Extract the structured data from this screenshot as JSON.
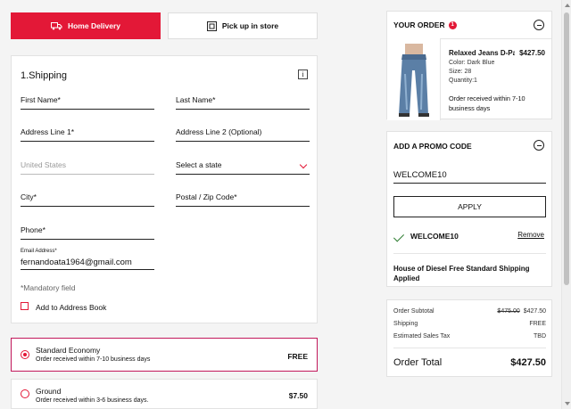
{
  "delivery": {
    "home_label": "Home Delivery",
    "pickup_label": "Pick up in store"
  },
  "shipping": {
    "title": "1.Shipping",
    "first_name": "First Name*",
    "last_name": "Last Name*",
    "address1": "Address Line 1*",
    "address2": "Address Line 2 (Optional)",
    "country": "United States",
    "state": "Select a state",
    "city": "City*",
    "postal": "Postal / Zip Code*",
    "phone": "Phone*",
    "email_label": "Email Address*",
    "email_value": "fernandoata1964@gmail.com",
    "mandatory": "*Mandatory field",
    "address_book": "Add to Address Book"
  },
  "shipping_options": [
    {
      "name": "Standard Economy",
      "sub": "Order received within 7-10 business days",
      "price": "FREE",
      "selected": true
    },
    {
      "name": "Ground",
      "sub": "Order received within 3-6 business days.",
      "price": "$7.50",
      "selected": false
    }
  ],
  "order": {
    "title": "YOUR ORDER",
    "count": "1",
    "product_name": "Relaxed Jeans D-Pan",
    "product_price": "$427.50",
    "color": "Color: Dark Blue",
    "size": "Size: 28",
    "quantity": "Quantity:1",
    "note": "Order received within 7-10 business days"
  },
  "promo": {
    "title": "ADD A PROMO CODE",
    "input_value": "WELCOME10",
    "apply_label": "APPLY",
    "applied_code": "WELCOME10",
    "remove_label": "Remove",
    "shipping_promo": "House of Diesel Free Standard Shipping Applied"
  },
  "totals": {
    "subtotal_label": "Order Subtotal",
    "subtotal_original": "$475.00",
    "subtotal_value": "$427.50",
    "shipping_label": "Shipping",
    "shipping_value": "FREE",
    "tax_label": "Estimated Sales Tax",
    "tax_value": "TBD",
    "total_label": "Order Total",
    "total_value": "$427.50"
  },
  "colors": {
    "accent": "#e31837",
    "selected_border": "#c2185b",
    "success": "#2e7d32"
  }
}
